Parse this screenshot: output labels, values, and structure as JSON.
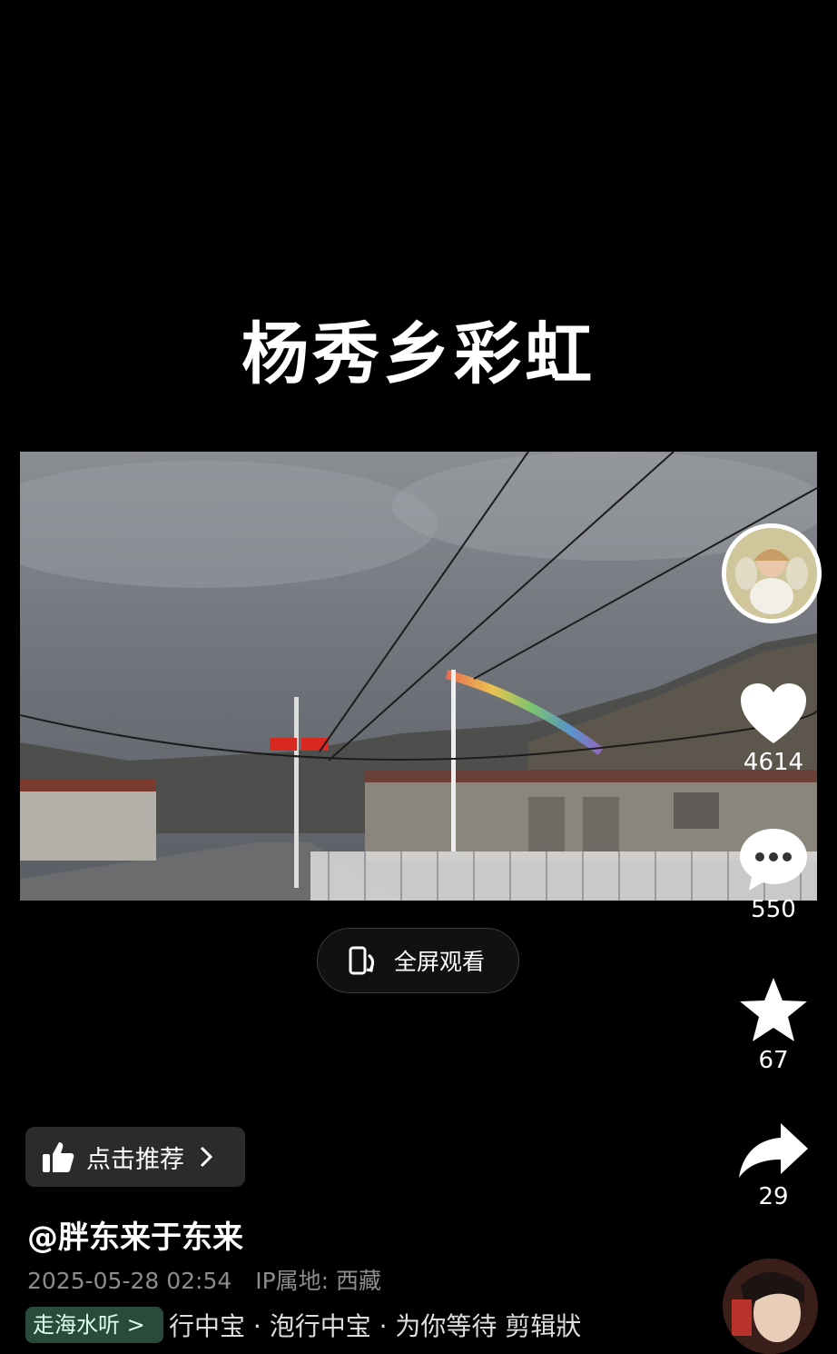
{
  "video": {
    "title": "杨秀乡彩虹"
  },
  "fullscreen": {
    "label": "全屏观看",
    "icon": "rotate-phone-icon"
  },
  "actions": {
    "like": {
      "icon": "heart-icon",
      "count": "4614"
    },
    "comment": {
      "icon": "comment-bubble-icon",
      "count": "550"
    },
    "favorite": {
      "icon": "star-icon",
      "count": "67"
    },
    "share": {
      "icon": "share-arrow-icon",
      "count": "29"
    }
  },
  "recommend": {
    "label": "点击推荐",
    "icon": "thumbs-up-icon"
  },
  "author": {
    "name": "@胖东来于东来"
  },
  "meta": {
    "datetime": "2025-05-28 02:54",
    "ip_location": "IP属地: 西藏"
  },
  "music": {
    "tag": "走海水听 >"
  },
  "description": "行中宝 · 泡行中宝 · 为你等待 剪辑狀"
}
